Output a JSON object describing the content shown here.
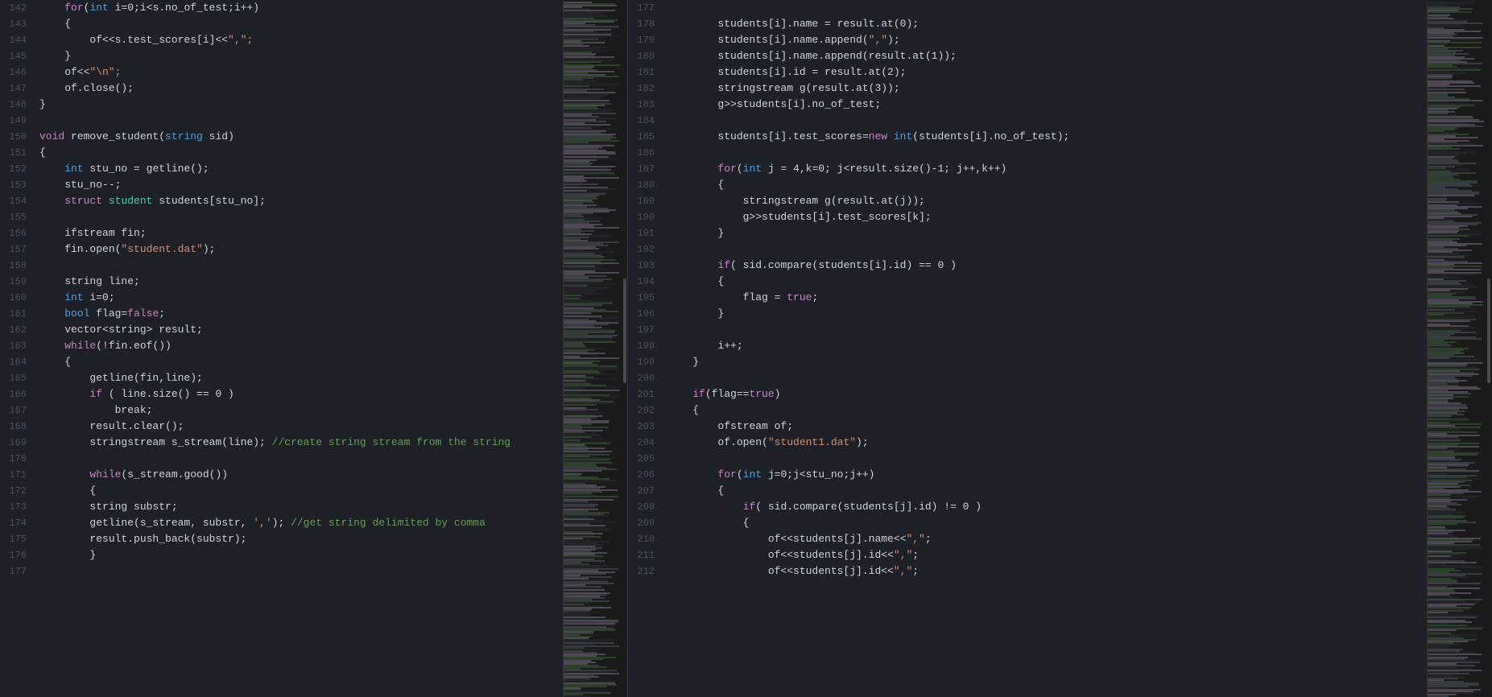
{
  "left_pane": {
    "lines": [
      {
        "num": "142",
        "tokens": [
          {
            "t": "    ",
            "c": "plain"
          },
          {
            "t": "for",
            "c": "kw"
          },
          {
            "t": "(",
            "c": "punct"
          },
          {
            "t": "int",
            "c": "kw2"
          },
          {
            "t": " i=0;i<s.no_of_test;i++)",
            "c": "plain"
          }
        ]
      },
      {
        "num": "143",
        "tokens": [
          {
            "t": "    {",
            "c": "plain"
          }
        ]
      },
      {
        "num": "144",
        "tokens": [
          {
            "t": "        of<<s.test_scores[i]<<",
            "c": "plain"
          },
          {
            "t": "\",\";",
            "c": "str"
          }
        ]
      },
      {
        "num": "145",
        "tokens": [
          {
            "t": "    }",
            "c": "plain"
          }
        ]
      },
      {
        "num": "146",
        "tokens": [
          {
            "t": "    of<<",
            "c": "plain"
          },
          {
            "t": "\"\\n\";",
            "c": "str"
          }
        ]
      },
      {
        "num": "147",
        "tokens": [
          {
            "t": "    of.close();",
            "c": "plain"
          }
        ]
      },
      {
        "num": "148",
        "tokens": [
          {
            "t": "}",
            "c": "plain"
          }
        ]
      },
      {
        "num": "149",
        "tokens": [
          {
            "t": "",
            "c": "plain"
          }
        ]
      },
      {
        "num": "150",
        "tokens": [
          {
            "t": "void",
            "c": "kw"
          },
          {
            "t": " remove_student(",
            "c": "plain"
          },
          {
            "t": "string",
            "c": "kw2"
          },
          {
            "t": " sid)",
            "c": "plain"
          }
        ]
      },
      {
        "num": "151",
        "tokens": [
          {
            "t": "{",
            "c": "plain"
          }
        ]
      },
      {
        "num": "152",
        "tokens": [
          {
            "t": "    ",
            "c": "plain"
          },
          {
            "t": "int",
            "c": "kw2"
          },
          {
            "t": " stu_no = getline();",
            "c": "plain"
          }
        ]
      },
      {
        "num": "153",
        "tokens": [
          {
            "t": "    stu_no--;",
            "c": "plain"
          }
        ]
      },
      {
        "num": "154",
        "tokens": [
          {
            "t": "    ",
            "c": "plain"
          },
          {
            "t": "struct",
            "c": "kw"
          },
          {
            "t": " ",
            "c": "plain"
          },
          {
            "t": "student",
            "c": "cls"
          },
          {
            "t": " students[stu_no];",
            "c": "plain"
          }
        ]
      },
      {
        "num": "155",
        "tokens": [
          {
            "t": "",
            "c": "plain"
          }
        ]
      },
      {
        "num": "156",
        "tokens": [
          {
            "t": "    ifstream fin;",
            "c": "plain"
          }
        ]
      },
      {
        "num": "157",
        "tokens": [
          {
            "t": "    fin.open(",
            "c": "plain"
          },
          {
            "t": "\"student.dat\"",
            "c": "str"
          },
          {
            "t": ");",
            "c": "plain"
          }
        ]
      },
      {
        "num": "158",
        "tokens": [
          {
            "t": "",
            "c": "plain"
          }
        ]
      },
      {
        "num": "159",
        "tokens": [
          {
            "t": "    string line;",
            "c": "plain"
          }
        ]
      },
      {
        "num": "160",
        "tokens": [
          {
            "t": "    ",
            "c": "plain"
          },
          {
            "t": "int",
            "c": "kw2"
          },
          {
            "t": " i=0;",
            "c": "plain"
          }
        ]
      },
      {
        "num": "161",
        "tokens": [
          {
            "t": "    ",
            "c": "plain"
          },
          {
            "t": "bool",
            "c": "kw2"
          },
          {
            "t": " flag=",
            "c": "plain"
          },
          {
            "t": "false",
            "c": "kw"
          },
          {
            "t": ";",
            "c": "plain"
          }
        ]
      },
      {
        "num": "162",
        "tokens": [
          {
            "t": "    vector<string> result;",
            "c": "plain"
          }
        ]
      },
      {
        "num": "163",
        "tokens": [
          {
            "t": "    ",
            "c": "plain"
          },
          {
            "t": "while",
            "c": "kw"
          },
          {
            "t": "(!fin.eof())",
            "c": "plain"
          }
        ]
      },
      {
        "num": "164",
        "tokens": [
          {
            "t": "    {",
            "c": "plain"
          }
        ]
      },
      {
        "num": "165",
        "tokens": [
          {
            "t": "        getline(fin,line);",
            "c": "plain"
          }
        ]
      },
      {
        "num": "166",
        "tokens": [
          {
            "t": "        ",
            "c": "plain"
          },
          {
            "t": "if",
            "c": "kw"
          },
          {
            "t": " ( line.size() == 0 )",
            "c": "plain"
          }
        ]
      },
      {
        "num": "167",
        "tokens": [
          {
            "t": "            break;",
            "c": "plain"
          }
        ]
      },
      {
        "num": "168",
        "tokens": [
          {
            "t": "        result.clear();",
            "c": "plain"
          }
        ]
      },
      {
        "num": "169",
        "tokens": [
          {
            "t": "        stringstream s_stream(line); ",
            "c": "plain"
          },
          {
            "t": "//create string stream from the string",
            "c": "cmt"
          }
        ]
      },
      {
        "num": "170",
        "tokens": [
          {
            "t": "",
            "c": "plain"
          }
        ]
      },
      {
        "num": "171",
        "tokens": [
          {
            "t": "        ",
            "c": "plain"
          },
          {
            "t": "while",
            "c": "kw"
          },
          {
            "t": "(s_stream.good())",
            "c": "plain"
          }
        ]
      },
      {
        "num": "172",
        "tokens": [
          {
            "t": "        {",
            "c": "plain"
          }
        ]
      },
      {
        "num": "173",
        "tokens": [
          {
            "t": "        string substr;",
            "c": "plain"
          }
        ]
      },
      {
        "num": "174",
        "tokens": [
          {
            "t": "        getline(s_stream, substr, ",
            "c": "plain"
          },
          {
            "t": "','",
            "c": "str"
          },
          {
            "t": "); ",
            "c": "plain"
          },
          {
            "t": "//get string delimited by comma",
            "c": "cmt"
          }
        ]
      },
      {
        "num": "175",
        "tokens": [
          {
            "t": "        result.push_back(substr);",
            "c": "plain"
          }
        ]
      },
      {
        "num": "176",
        "tokens": [
          {
            "t": "        }",
            "c": "plain"
          }
        ]
      },
      {
        "num": "177",
        "tokens": [
          {
            "t": "",
            "c": "plain"
          }
        ]
      }
    ]
  },
  "right_pane": {
    "lines": [
      {
        "num": "177",
        "tokens": [
          {
            "t": "",
            "c": "plain"
          }
        ]
      },
      {
        "num": "178",
        "tokens": [
          {
            "t": "        students[i].name = result.at(0);",
            "c": "plain"
          }
        ]
      },
      {
        "num": "179",
        "tokens": [
          {
            "t": "        students[i].name.append(",
            "c": "plain"
          },
          {
            "t": "\",\"",
            "c": "str"
          },
          {
            "t": ");",
            "c": "plain"
          }
        ]
      },
      {
        "num": "180",
        "tokens": [
          {
            "t": "        students[i].name.append(result.at(1));",
            "c": "plain"
          }
        ]
      },
      {
        "num": "181",
        "tokens": [
          {
            "t": "        students[i].id = result.at(2);",
            "c": "plain"
          }
        ]
      },
      {
        "num": "182",
        "tokens": [
          {
            "t": "        stringstream g(result.at(3));",
            "c": "plain"
          }
        ]
      },
      {
        "num": "183",
        "tokens": [
          {
            "t": "        g>>students[i].no_of_test;",
            "c": "plain"
          }
        ]
      },
      {
        "num": "184",
        "tokens": [
          {
            "t": "",
            "c": "plain"
          }
        ]
      },
      {
        "num": "185",
        "tokens": [
          {
            "t": "        students[i].test_scores=",
            "c": "plain"
          },
          {
            "t": "new",
            "c": "kw"
          },
          {
            "t": " ",
            "c": "plain"
          },
          {
            "t": "int",
            "c": "kw2"
          },
          {
            "t": "(students[i].no_of_test);",
            "c": "plain"
          }
        ]
      },
      {
        "num": "186",
        "tokens": [
          {
            "t": "",
            "c": "plain"
          }
        ]
      },
      {
        "num": "187",
        "tokens": [
          {
            "t": "        ",
            "c": "plain"
          },
          {
            "t": "for",
            "c": "kw"
          },
          {
            "t": "(",
            "c": "plain"
          },
          {
            "t": "int",
            "c": "kw2"
          },
          {
            "t": " j = 4,k=0; j<result.size()-1; j++,k++)",
            "c": "plain"
          }
        ]
      },
      {
        "num": "188",
        "tokens": [
          {
            "t": "        {",
            "c": "plain"
          }
        ]
      },
      {
        "num": "189",
        "tokens": [
          {
            "t": "            stringstream g(result.at(j));",
            "c": "plain"
          }
        ]
      },
      {
        "num": "190",
        "tokens": [
          {
            "t": "            g>>students[i].test_scores[k];",
            "c": "plain"
          }
        ]
      },
      {
        "num": "191",
        "tokens": [
          {
            "t": "        }",
            "c": "plain"
          }
        ]
      },
      {
        "num": "192",
        "tokens": [
          {
            "t": "",
            "c": "plain"
          }
        ]
      },
      {
        "num": "193",
        "tokens": [
          {
            "t": "        ",
            "c": "plain"
          },
          {
            "t": "if",
            "c": "kw"
          },
          {
            "t": "( sid.compare(students[i].id) == 0 )",
            "c": "plain"
          }
        ]
      },
      {
        "num": "194",
        "tokens": [
          {
            "t": "        {",
            "c": "plain"
          }
        ]
      },
      {
        "num": "195",
        "tokens": [
          {
            "t": "            flag = ",
            "c": "plain"
          },
          {
            "t": "true",
            "c": "kw"
          },
          {
            "t": ";",
            "c": "plain"
          }
        ]
      },
      {
        "num": "196",
        "tokens": [
          {
            "t": "        }",
            "c": "plain"
          }
        ]
      },
      {
        "num": "197",
        "tokens": [
          {
            "t": "",
            "c": "plain"
          }
        ]
      },
      {
        "num": "198",
        "tokens": [
          {
            "t": "        i++;",
            "c": "plain"
          }
        ]
      },
      {
        "num": "199",
        "tokens": [
          {
            "t": "    }",
            "c": "plain"
          }
        ]
      },
      {
        "num": "200",
        "tokens": [
          {
            "t": "",
            "c": "plain"
          }
        ]
      },
      {
        "num": "201",
        "tokens": [
          {
            "t": "    ",
            "c": "plain"
          },
          {
            "t": "if",
            "c": "kw"
          },
          {
            "t": "(flag==",
            "c": "plain"
          },
          {
            "t": "true",
            "c": "kw"
          },
          {
            "t": ")",
            "c": "plain"
          }
        ]
      },
      {
        "num": "202",
        "tokens": [
          {
            "t": "    {",
            "c": "plain"
          }
        ]
      },
      {
        "num": "203",
        "tokens": [
          {
            "t": "        ofstream of;",
            "c": "plain"
          }
        ]
      },
      {
        "num": "204",
        "tokens": [
          {
            "t": "        of.open(",
            "c": "plain"
          },
          {
            "t": "\"student1.dat\"",
            "c": "str"
          },
          {
            "t": ");",
            "c": "plain"
          }
        ]
      },
      {
        "num": "205",
        "tokens": [
          {
            "t": "",
            "c": "plain"
          }
        ]
      },
      {
        "num": "206",
        "tokens": [
          {
            "t": "        ",
            "c": "plain"
          },
          {
            "t": "for",
            "c": "kw"
          },
          {
            "t": "(",
            "c": "plain"
          },
          {
            "t": "int",
            "c": "kw2"
          },
          {
            "t": " j=0;j<stu_no;j++)",
            "c": "plain"
          }
        ]
      },
      {
        "num": "207",
        "tokens": [
          {
            "t": "        {",
            "c": "plain"
          }
        ]
      },
      {
        "num": "208",
        "tokens": [
          {
            "t": "            ",
            "c": "plain"
          },
          {
            "t": "if",
            "c": "kw"
          },
          {
            "t": "( sid.compare(students[j].id) != 0 )",
            "c": "plain"
          }
        ]
      },
      {
        "num": "209",
        "tokens": [
          {
            "t": "            {",
            "c": "plain"
          }
        ]
      },
      {
        "num": "210",
        "tokens": [
          {
            "t": "                of<<students[j].name<<",
            "c": "plain"
          },
          {
            "t": "\",\"",
            "c": "str"
          },
          {
            "t": ";",
            "c": "plain"
          }
        ]
      },
      {
        "num": "211",
        "tokens": [
          {
            "t": "                of<<students[j].id<<",
            "c": "plain"
          },
          {
            "t": "\",\"",
            "c": "str"
          },
          {
            "t": ";",
            "c": "plain"
          }
        ]
      },
      {
        "num": "212",
        "tokens": [
          {
            "t": "                of<<students[j].id<<",
            "c": "plain"
          },
          {
            "t": "\",\"",
            "c": "str"
          },
          {
            "t": ";",
            "c": "plain"
          }
        ]
      }
    ]
  }
}
